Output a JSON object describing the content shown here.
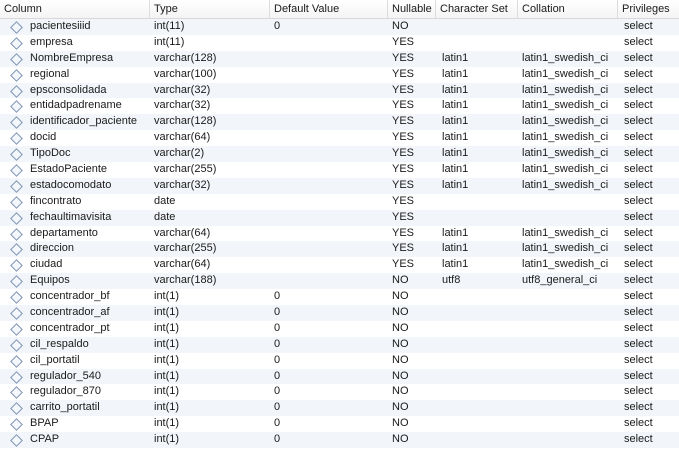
{
  "headers": {
    "column": "Column",
    "type": "Type",
    "default": "Default Value",
    "nullable": "Nullable",
    "charset": "Character Set",
    "collation": "Collation",
    "privileges": "Privileges"
  },
  "rows": [
    {
      "name": "pacientesiiid",
      "type": "int(11)",
      "default": "0",
      "nullable": "NO",
      "charset": "",
      "collation": "",
      "privileges": "select"
    },
    {
      "name": "empresa",
      "type": "int(11)",
      "default": "",
      "nullable": "YES",
      "charset": "",
      "collation": "",
      "privileges": "select"
    },
    {
      "name": "NombreEmpresa",
      "type": "varchar(128)",
      "default": "",
      "nullable": "YES",
      "charset": "latin1",
      "collation": "latin1_swedish_ci",
      "privileges": "select"
    },
    {
      "name": "regional",
      "type": "varchar(100)",
      "default": "",
      "nullable": "YES",
      "charset": "latin1",
      "collation": "latin1_swedish_ci",
      "privileges": "select"
    },
    {
      "name": "epsconsolidada",
      "type": "varchar(32)",
      "default": "",
      "nullable": "YES",
      "charset": "latin1",
      "collation": "latin1_swedish_ci",
      "privileges": "select"
    },
    {
      "name": "entidadpadrename",
      "type": "varchar(32)",
      "default": "",
      "nullable": "YES",
      "charset": "latin1",
      "collation": "latin1_swedish_ci",
      "privileges": "select"
    },
    {
      "name": "identificador_paciente",
      "type": "varchar(128)",
      "default": "",
      "nullable": "YES",
      "charset": "latin1",
      "collation": "latin1_swedish_ci",
      "privileges": "select"
    },
    {
      "name": "docid",
      "type": "varchar(64)",
      "default": "",
      "nullable": "YES",
      "charset": "latin1",
      "collation": "latin1_swedish_ci",
      "privileges": "select"
    },
    {
      "name": "TipoDoc",
      "type": "varchar(2)",
      "default": "",
      "nullable": "YES",
      "charset": "latin1",
      "collation": "latin1_swedish_ci",
      "privileges": "select"
    },
    {
      "name": "EstadoPaciente",
      "type": "varchar(255)",
      "default": "",
      "nullable": "YES",
      "charset": "latin1",
      "collation": "latin1_swedish_ci",
      "privileges": "select"
    },
    {
      "name": "estadocomodato",
      "type": "varchar(32)",
      "default": "",
      "nullable": "YES",
      "charset": "latin1",
      "collation": "latin1_swedish_ci",
      "privileges": "select"
    },
    {
      "name": "fincontrato",
      "type": "date",
      "default": "",
      "nullable": "YES",
      "charset": "",
      "collation": "",
      "privileges": "select"
    },
    {
      "name": "fechaultimavisita",
      "type": "date",
      "default": "",
      "nullable": "YES",
      "charset": "",
      "collation": "",
      "privileges": "select"
    },
    {
      "name": "departamento",
      "type": "varchar(64)",
      "default": "",
      "nullable": "YES",
      "charset": "latin1",
      "collation": "latin1_swedish_ci",
      "privileges": "select"
    },
    {
      "name": "direccion",
      "type": "varchar(255)",
      "default": "",
      "nullable": "YES",
      "charset": "latin1",
      "collation": "latin1_swedish_ci",
      "privileges": "select"
    },
    {
      "name": "ciudad",
      "type": "varchar(64)",
      "default": "",
      "nullable": "YES",
      "charset": "latin1",
      "collation": "latin1_swedish_ci",
      "privileges": "select"
    },
    {
      "name": "Equipos",
      "type": "varchar(188)",
      "default": "",
      "nullable": "NO",
      "charset": "utf8",
      "collation": "utf8_general_ci",
      "privileges": "select"
    },
    {
      "name": "concentrador_bf",
      "type": "int(1)",
      "default": "0",
      "nullable": "NO",
      "charset": "",
      "collation": "",
      "privileges": "select"
    },
    {
      "name": "concentrador_af",
      "type": "int(1)",
      "default": "0",
      "nullable": "NO",
      "charset": "",
      "collation": "",
      "privileges": "select"
    },
    {
      "name": "concentrador_pt",
      "type": "int(1)",
      "default": "0",
      "nullable": "NO",
      "charset": "",
      "collation": "",
      "privileges": "select"
    },
    {
      "name": "cil_respaldo",
      "type": "int(1)",
      "default": "0",
      "nullable": "NO",
      "charset": "",
      "collation": "",
      "privileges": "select"
    },
    {
      "name": "cil_portatil",
      "type": "int(1)",
      "default": "0",
      "nullable": "NO",
      "charset": "",
      "collation": "",
      "privileges": "select"
    },
    {
      "name": "regulador_540",
      "type": "int(1)",
      "default": "0",
      "nullable": "NO",
      "charset": "",
      "collation": "",
      "privileges": "select"
    },
    {
      "name": "regulador_870",
      "type": "int(1)",
      "default": "0",
      "nullable": "NO",
      "charset": "",
      "collation": "",
      "privileges": "select"
    },
    {
      "name": "carrito_portatil",
      "type": "int(1)",
      "default": "0",
      "nullable": "NO",
      "charset": "",
      "collation": "",
      "privileges": "select"
    },
    {
      "name": "BPAP",
      "type": "int(1)",
      "default": "0",
      "nullable": "NO",
      "charset": "",
      "collation": "",
      "privileges": "select"
    },
    {
      "name": "CPAP",
      "type": "int(1)",
      "default": "0",
      "nullable": "NO",
      "charset": "",
      "collation": "",
      "privileges": "select"
    }
  ]
}
